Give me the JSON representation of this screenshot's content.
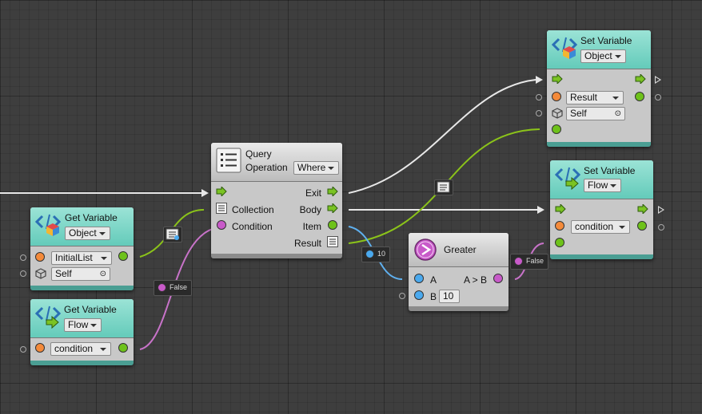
{
  "nodes": {
    "set_object": {
      "title": "Set Variable",
      "kind": "Object",
      "name_value": "Result",
      "target_value": "Self"
    },
    "set_flow": {
      "title": "Set Variable",
      "kind": "Flow",
      "name_value": "condition"
    },
    "query": {
      "title": "Query",
      "operation_label": "Operation",
      "operation_value": "Where",
      "ports": {
        "exit": "Exit",
        "collection": "Collection",
        "body": "Body",
        "condition": "Condition",
        "item": "Item",
        "result": "Result"
      }
    },
    "get_object": {
      "title": "Get Variable",
      "kind": "Object",
      "name_value": "InitialList",
      "target_value": "Self"
    },
    "get_flow": {
      "title": "Get Variable",
      "kind": "Flow",
      "name_value": "condition"
    },
    "greater": {
      "title": "Greater",
      "ports": {
        "a": "A",
        "b": "B",
        "out": "A > B"
      },
      "b_value": "10"
    }
  },
  "wire_chips": {
    "item_value": "10",
    "false_left": "False",
    "false_right": "False"
  },
  "colors": {
    "control_wire": "#e8e8e8",
    "list_wire": "#8bc31a",
    "number_wire": "#5fb0ef",
    "bool_wire": "#c873c9",
    "teal_header": "#64cbba"
  }
}
